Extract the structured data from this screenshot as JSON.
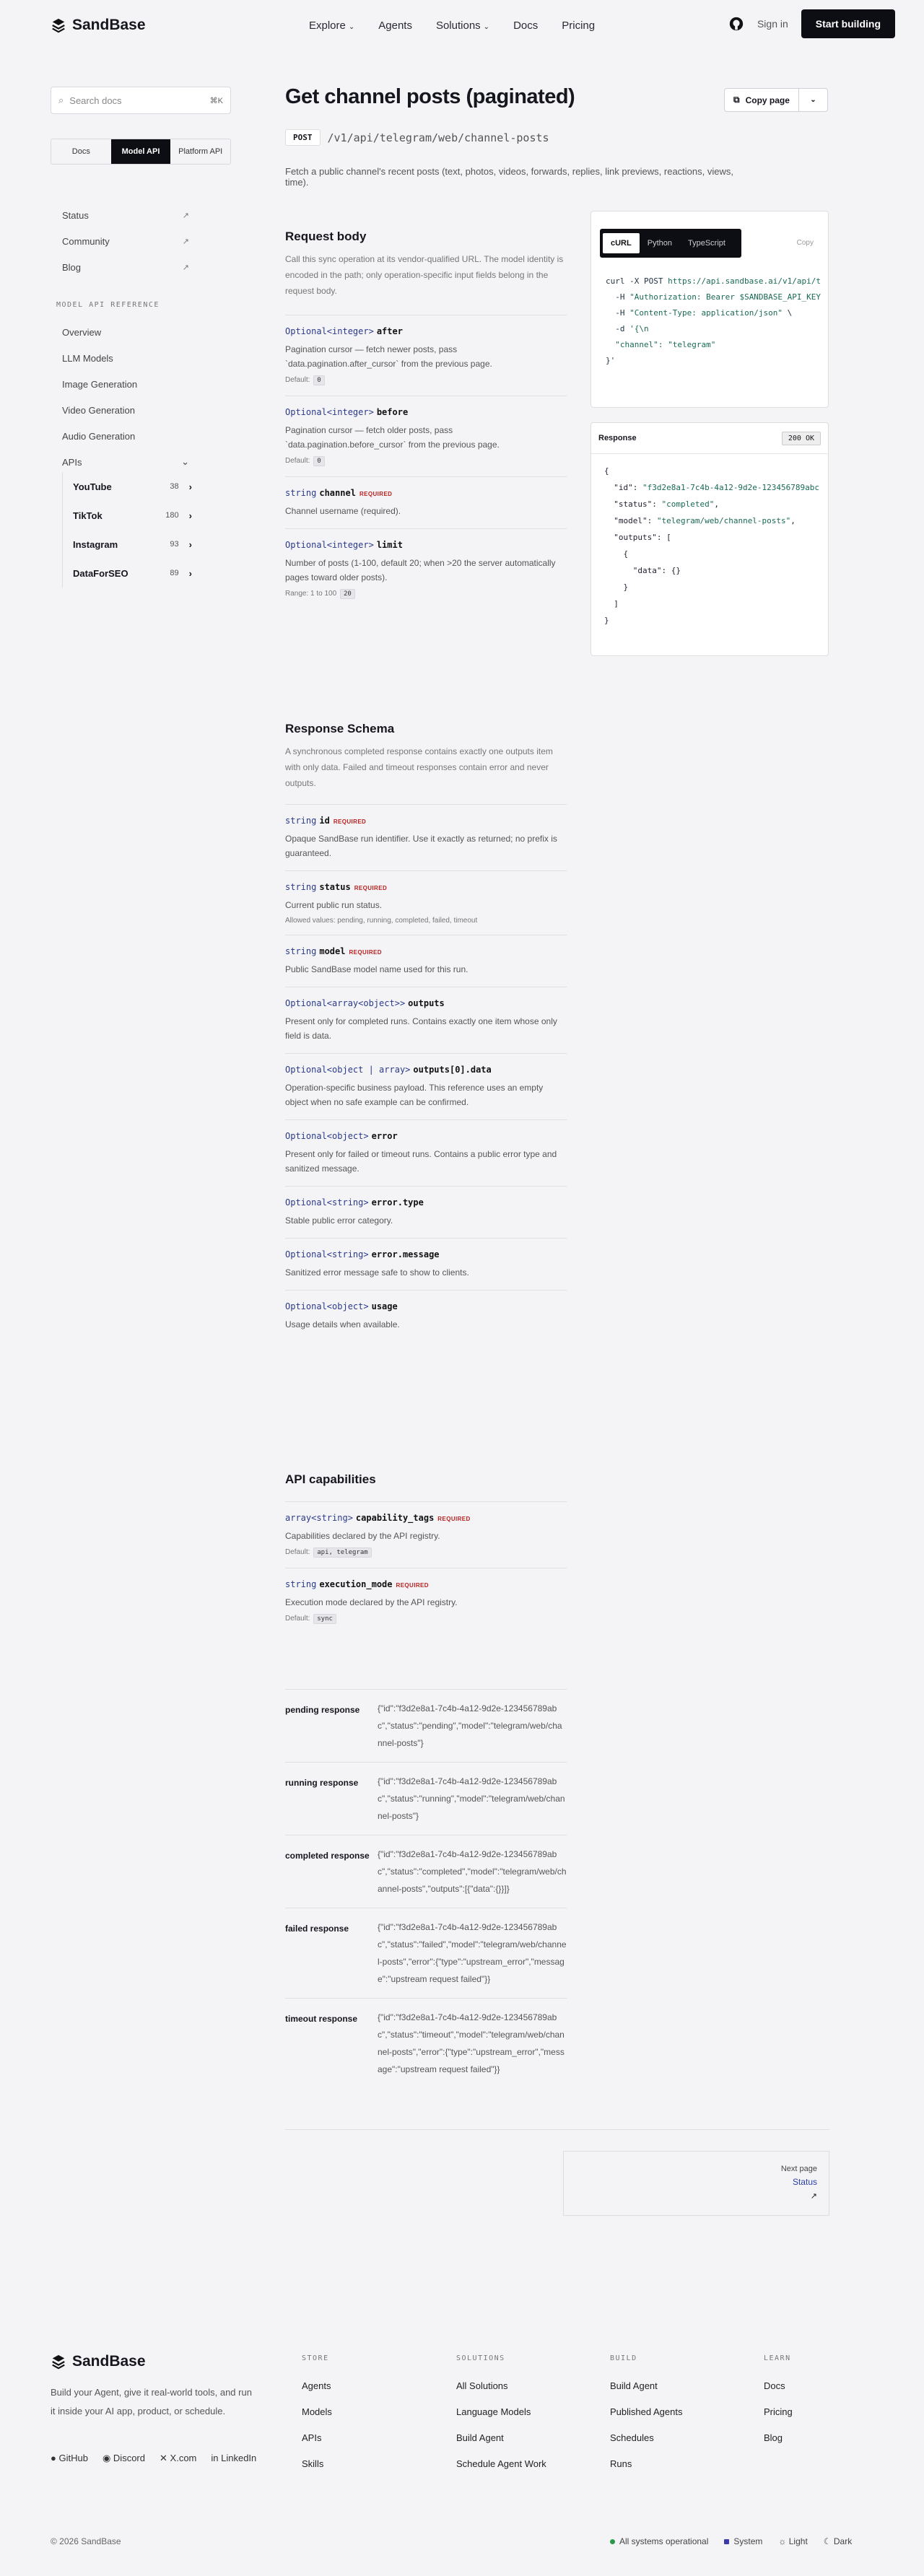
{
  "header": {
    "brand": "SandBase",
    "nav": [
      "Explore",
      "Agents",
      "Solutions",
      "Docs",
      "Pricing"
    ],
    "signin": "Sign in",
    "start": "Start building"
  },
  "sidebar": {
    "search_placeholder": "Search docs",
    "kbd": "⌘K",
    "tabs": [
      "Docs",
      "Model API",
      "Platform API"
    ],
    "links": [
      {
        "label": "Status"
      },
      {
        "label": "Community"
      },
      {
        "label": "Blog"
      }
    ],
    "section": "MODEL API REFERENCE",
    "items": [
      "Overview",
      "LLM Models",
      "Image Generation",
      "Video Generation",
      "Audio Generation",
      "APIs"
    ],
    "apis": [
      {
        "label": "YouTube",
        "count": "38"
      },
      {
        "label": "TikTok",
        "count": "180"
      },
      {
        "label": "Instagram",
        "count": "93"
      },
      {
        "label": "DataForSEO",
        "count": "89"
      }
    ]
  },
  "page": {
    "title": "Get channel posts (paginated)",
    "copy": "Copy page",
    "method": "POST",
    "path": "/v1/api/telegram/web/channel-posts",
    "summary": "Fetch a public channel's recent posts (text, photos, videos, forwards, replies, link previews, reactions, views, time)."
  },
  "request": {
    "title": "Request body",
    "intro": "Call this sync operation at its vendor-qualified URL. The model identity is encoded in the path; only operation-specific input fields belong in the request body.",
    "params": [
      {
        "type": "Optional<integer>",
        "name": "after",
        "req": "",
        "desc": "Pagination cursor — fetch newer posts, pass `data.pagination.after_cursor` from the previous page.",
        "meta": "Default:",
        "badge": "0"
      },
      {
        "type": "Optional<integer>",
        "name": "before",
        "req": "",
        "desc": "Pagination cursor — fetch older posts, pass `data.pagination.before_cursor` from the previous page.",
        "meta": "Default:",
        "badge": "0"
      },
      {
        "type": "string",
        "name": "channel",
        "req": "REQUIRED",
        "desc": "Channel username (required).",
        "meta": "",
        "badge": ""
      },
      {
        "type": "Optional<integer>",
        "name": "limit",
        "req": "",
        "desc": "Number of posts (1-100, default 20; when >20 the server automatically pages toward older posts).",
        "meta": "Range: 1 to 100",
        "badge": "20"
      }
    ]
  },
  "schema": {
    "title": "Response Schema",
    "intro": "A synchronous completed response contains exactly one outputs item with only data. Failed and timeout responses contain error and never outputs.",
    "params": [
      {
        "type": "string",
        "name": "id",
        "req": "REQUIRED",
        "desc": "Opaque SandBase run identifier. Use it exactly as returned; no prefix is guaranteed.",
        "meta": ""
      },
      {
        "type": "string",
        "name": "status",
        "req": "REQUIRED",
        "desc": "Current public run status.",
        "meta": "Allowed values: pending, running, completed, failed, timeout"
      },
      {
        "type": "string",
        "name": "model",
        "req": "REQUIRED",
        "desc": "Public SandBase model name used for this run.",
        "meta": ""
      },
      {
        "type": "Optional<array<object>>",
        "name": "outputs",
        "req": "",
        "desc": "Present only for completed runs. Contains exactly one item whose only field is data.",
        "meta": ""
      },
      {
        "type": "Optional<object | array>",
        "name": "outputs[0].data",
        "req": "",
        "desc": "Operation-specific business payload. This reference uses an empty object when no safe example can be confirmed.",
        "meta": ""
      },
      {
        "type": "Optional<object>",
        "name": "error",
        "req": "",
        "desc": "Present only for failed or timeout runs. Contains a public error type and sanitized message.",
        "meta": ""
      },
      {
        "type": "Optional<string>",
        "name": "error.type",
        "req": "",
        "desc": "Stable public error category.",
        "meta": ""
      },
      {
        "type": "Optional<string>",
        "name": "error.message",
        "req": "",
        "desc": "Sanitized error message safe to show to clients.",
        "meta": ""
      },
      {
        "type": "Optional<object>",
        "name": "usage",
        "req": "",
        "desc": "Usage details when available.",
        "meta": ""
      }
    ]
  },
  "capabilities": {
    "title": "API capabilities",
    "params": [
      {
        "type": "array<string>",
        "name": "capability_tags",
        "req": "REQUIRED",
        "desc": "Capabilities declared by the API registry.",
        "meta": "Default:",
        "badge": "api, telegram"
      },
      {
        "type": "string",
        "name": "execution_mode",
        "req": "REQUIRED",
        "desc": "Execution mode declared by the API registry.",
        "meta": "Default:",
        "badge": "sync"
      }
    ]
  },
  "examples": [
    {
      "k": "pending response",
      "v": "{\"id\":\"f3d2e8a1-7c4b-4a12-9d2e-123456789abc\",\"status\":\"pending\",\"model\":\"telegram/web/channel-posts\"}"
    },
    {
      "k": "running response",
      "v": "{\"id\":\"f3d2e8a1-7c4b-4a12-9d2e-123456789abc\",\"status\":\"running\",\"model\":\"telegram/web/channel-posts\"}"
    },
    {
      "k": "completed response",
      "v": "{\"id\":\"f3d2e8a1-7c4b-4a12-9d2e-123456789abc\",\"status\":\"completed\",\"model\":\"telegram/web/channel-posts\",\"outputs\":[{\"data\":{}}]}"
    },
    {
      "k": "failed response",
      "v": "{\"id\":\"f3d2e8a1-7c4b-4a12-9d2e-123456789abc\",\"status\":\"failed\",\"model\":\"telegram/web/channel-posts\",\"error\":{\"type\":\"upstream_error\",\"message\":\"upstream request failed\"}}"
    },
    {
      "k": "timeout response",
      "v": "{\"id\":\"f3d2e8a1-7c4b-4a12-9d2e-123456789abc\",\"status\":\"timeout\",\"model\":\"telegram/web/channel-posts\",\"error\":{\"type\":\"upstream_error\",\"message\":\"upstream request failed\"}}"
    }
  ],
  "code": {
    "tabs": [
      "cURL",
      "Python",
      "TypeScript"
    ],
    "copy": "Copy"
  },
  "response": {
    "label": "Response",
    "status": "200 OK"
  },
  "pager": {
    "label": "Next page",
    "next": "Status"
  },
  "footer": {
    "brand": "SandBase",
    "tagline": "Build your Agent, give it real-world tools, and run it inside your AI app, product, or schedule.",
    "social": [
      "GitHub",
      "Discord",
      "X.com",
      "LinkedIn"
    ],
    "cols": [
      {
        "h": "STORE",
        "items": [
          "Agents",
          "Models",
          "APIs",
          "Skills"
        ]
      },
      {
        "h": "SOLUTIONS",
        "items": [
          "All Solutions",
          "Language Models",
          "Build Agent",
          "Schedule Agent Work"
        ]
      },
      {
        "h": "BUILD",
        "items": [
          "Build Agent",
          "Published Agents",
          "Schedules",
          "Runs"
        ]
      },
      {
        "h": "LEARN",
        "items": [
          "Docs",
          "Pricing",
          "Blog"
        ]
      }
    ],
    "copyright": "© 2026 SandBase",
    "status": "All systems operational",
    "themes": [
      "System",
      "Light",
      "Dark"
    ]
  }
}
